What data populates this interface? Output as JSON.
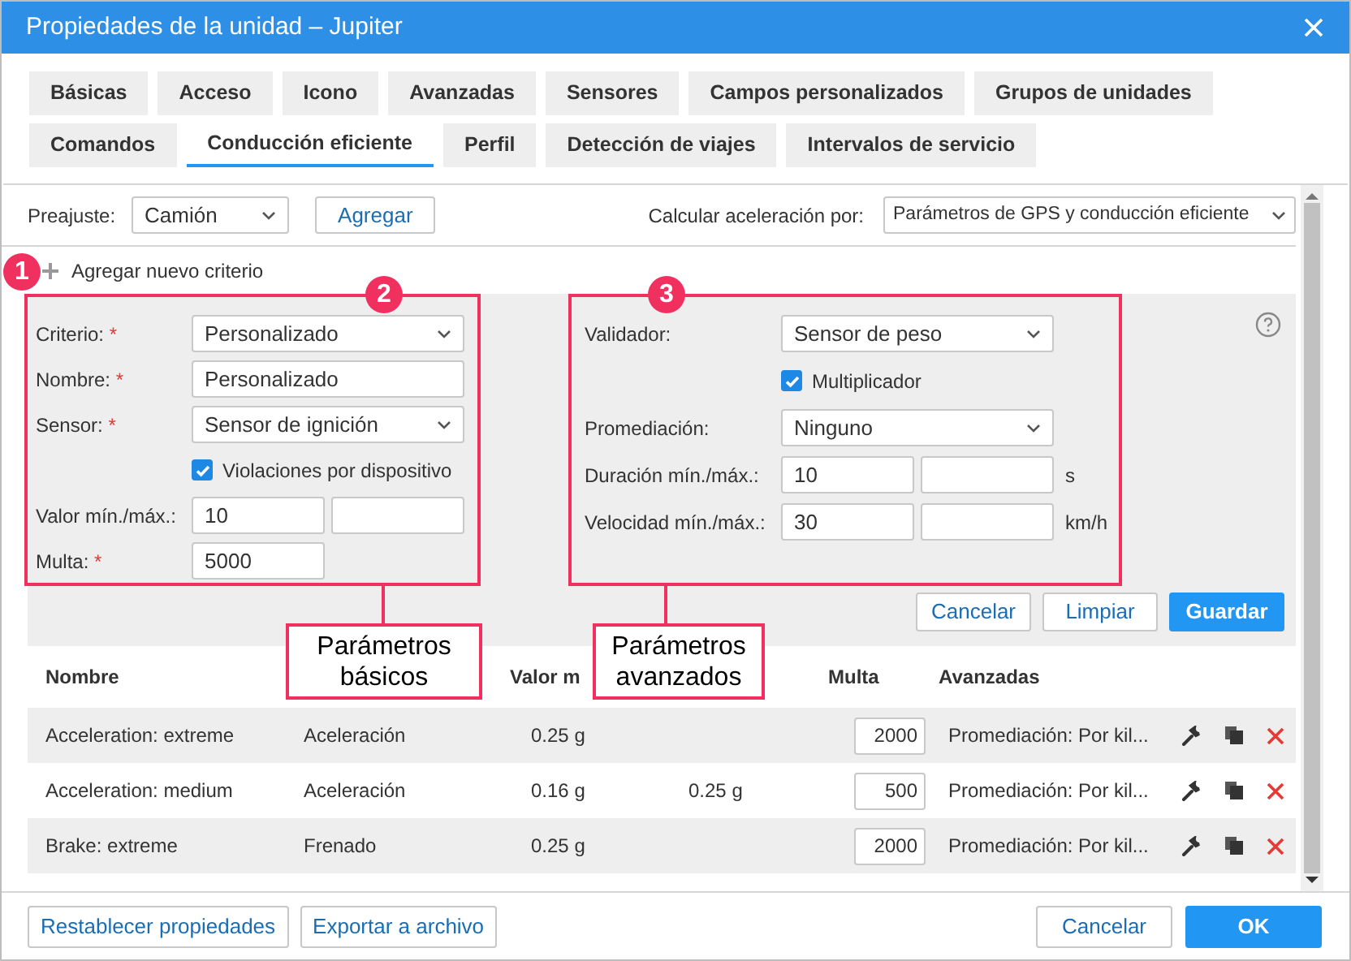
{
  "window": {
    "title": "Propiedades de la unidad – Jupiter"
  },
  "tab_rows": [
    [
      {
        "label": "Básicas",
        "selected": false
      },
      {
        "label": "Acceso",
        "selected": false
      },
      {
        "label": "Icono",
        "selected": false
      },
      {
        "label": "Avanzadas",
        "selected": false
      },
      {
        "label": "Sensores",
        "selected": false
      },
      {
        "label": "Campos personalizados",
        "selected": false
      },
      {
        "label": "Grupos de unidades",
        "selected": false
      }
    ],
    [
      {
        "label": "Comandos",
        "selected": false
      },
      {
        "label": "Conducción eficiente",
        "selected": true
      },
      {
        "label": "Perfil",
        "selected": false
      },
      {
        "label": "Detección de viajes",
        "selected": false
      },
      {
        "label": "Intervalos de servicio",
        "selected": false
      }
    ]
  ],
  "preset": {
    "label": "Preajuste:",
    "value": "Camión",
    "button": "Agregar"
  },
  "acceleration": {
    "label": "Calcular aceleración por:",
    "value": "Parámetros de GPS y conducción eficiente"
  },
  "add_criterion": "Agregar nuevo criterio",
  "required_mark": "*",
  "basic_form": [
    {
      "kind": "select",
      "label": "Criterio:",
      "required": true,
      "value": "Personalizado"
    },
    {
      "kind": "input",
      "label": "Nombre:",
      "required": true,
      "value": "Personalizado"
    },
    {
      "kind": "select",
      "label": "Sensor:",
      "required": true,
      "value": "Sensor de ignición"
    },
    {
      "kind": "checkbox",
      "label": "Violaciones por dispositivo",
      "checked": true
    },
    {
      "kind": "range",
      "label": "Valor mín./máx.:",
      "required": false,
      "min": "10"
    },
    {
      "kind": "short",
      "label": "Multa:",
      "required": true,
      "value": "5000"
    }
  ],
  "advanced_form": [
    {
      "kind": "select",
      "label": "Validador:",
      "required": false,
      "value": "Sensor de peso"
    },
    {
      "kind": "checkbox",
      "label": "Multiplicador",
      "checked": true
    },
    {
      "kind": "select",
      "label": "Promediación:",
      "required": false,
      "value": "Ninguno"
    },
    {
      "kind": "range",
      "label": "Duración mín./máx.:",
      "required": false,
      "min": "10",
      "unit": "s"
    },
    {
      "kind": "range",
      "label": "Velocidad mín./máx.:",
      "required": false,
      "min": "30",
      "unit": "km/h"
    }
  ],
  "form_buttons": [
    {
      "label": "Cancelar",
      "primary": false
    },
    {
      "label": "Limpiar",
      "primary": false
    },
    {
      "label": "Guardar",
      "primary": true
    }
  ],
  "table": {
    "columns": {
      "name": "Nombre",
      "min": "Valor m",
      "fine": "Multa",
      "advanced": "Avanzadas"
    },
    "rows": [
      {
        "name": "Acceleration: extreme",
        "type": "Aceleración",
        "min": "0.25 g",
        "fine": "2000",
        "advanced": "Promediación: Por kil..."
      },
      {
        "name": "Acceleration: medium",
        "type": "Aceleración",
        "min": "0.16 g",
        "max": "0.25 g",
        "fine": "500",
        "advanced": "Promediación: Por kil..."
      },
      {
        "name": "Brake: extreme",
        "type": "Frenado",
        "min": "0.25 g",
        "fine": "2000",
        "advanced": "Promediación: Por kil..."
      }
    ]
  },
  "footer": {
    "left": [
      "Restablecer propiedades",
      "Exportar a archivo"
    ],
    "right": [
      {
        "label": "Cancelar",
        "primary": false
      },
      {
        "label": "OK",
        "primary": true
      }
    ]
  },
  "annotations": [
    {
      "number": "1"
    },
    {
      "number": "2",
      "caption": "Parámetros básicos"
    },
    {
      "number": "3",
      "caption": "Parámetros avanzados"
    }
  ]
}
